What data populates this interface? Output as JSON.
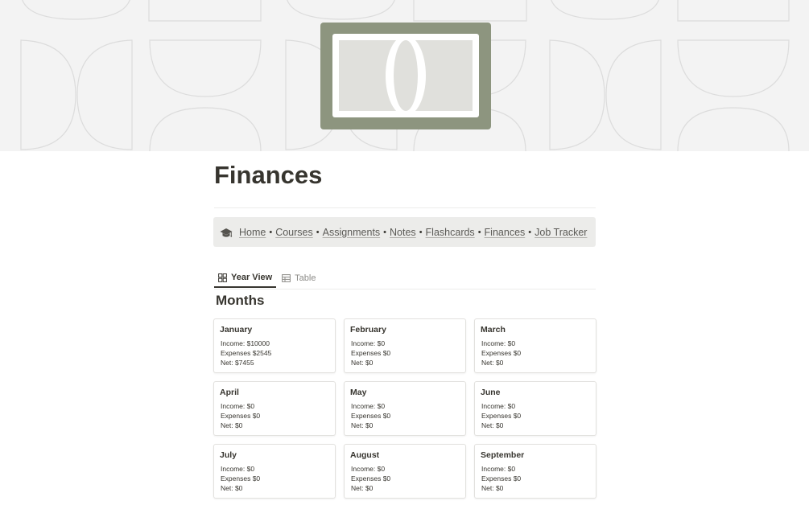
{
  "cover": {
    "icon": "dollar-bill-icon",
    "colors": {
      "background": "#f3f3f3",
      "pattern": "#dcdcdc",
      "bill_frame": "#8d957f",
      "bill_inner": "#e0e0dc"
    }
  },
  "page": {
    "title": "Finances"
  },
  "nav_callout": {
    "icon": "graduation-cap-icon",
    "separator": "•",
    "links": [
      "Home",
      "Courses",
      "Assignments",
      "Notes",
      "Flashcards",
      "Finances",
      "Job Tracker"
    ]
  },
  "view_tabs": [
    {
      "label": "Year View",
      "icon": "gallery-icon",
      "active": true
    },
    {
      "label": "Table",
      "icon": "table-icon",
      "active": false
    }
  ],
  "months_section": {
    "title": "Months"
  },
  "months": [
    {
      "name": "January",
      "income": "Income: $10000",
      "expenses": "Expenses $2545",
      "net": "Net: $7455"
    },
    {
      "name": "February",
      "income": "Income: $0",
      "expenses": "Expenses $0",
      "net": "Net: $0"
    },
    {
      "name": "March",
      "income": "Income: $0",
      "expenses": "Expenses $0",
      "net": "Net: $0"
    },
    {
      "name": "April",
      "income": "Income: $0",
      "expenses": "Expenses $0",
      "net": "Net: $0"
    },
    {
      "name": "May",
      "income": "Income: $0",
      "expenses": "Expenses $0",
      "net": "Net: $0"
    },
    {
      "name": "June",
      "income": "Income: $0",
      "expenses": "Expenses $0",
      "net": "Net: $0"
    },
    {
      "name": "July",
      "income": "Income: $0",
      "expenses": "Expenses $0",
      "net": "Net: $0"
    },
    {
      "name": "August",
      "income": "Income: $0",
      "expenses": "Expenses $0",
      "net": "Net: $0"
    },
    {
      "name": "September",
      "income": "Income: $0",
      "expenses": "Expenses $0",
      "net": "Net: $0"
    }
  ]
}
